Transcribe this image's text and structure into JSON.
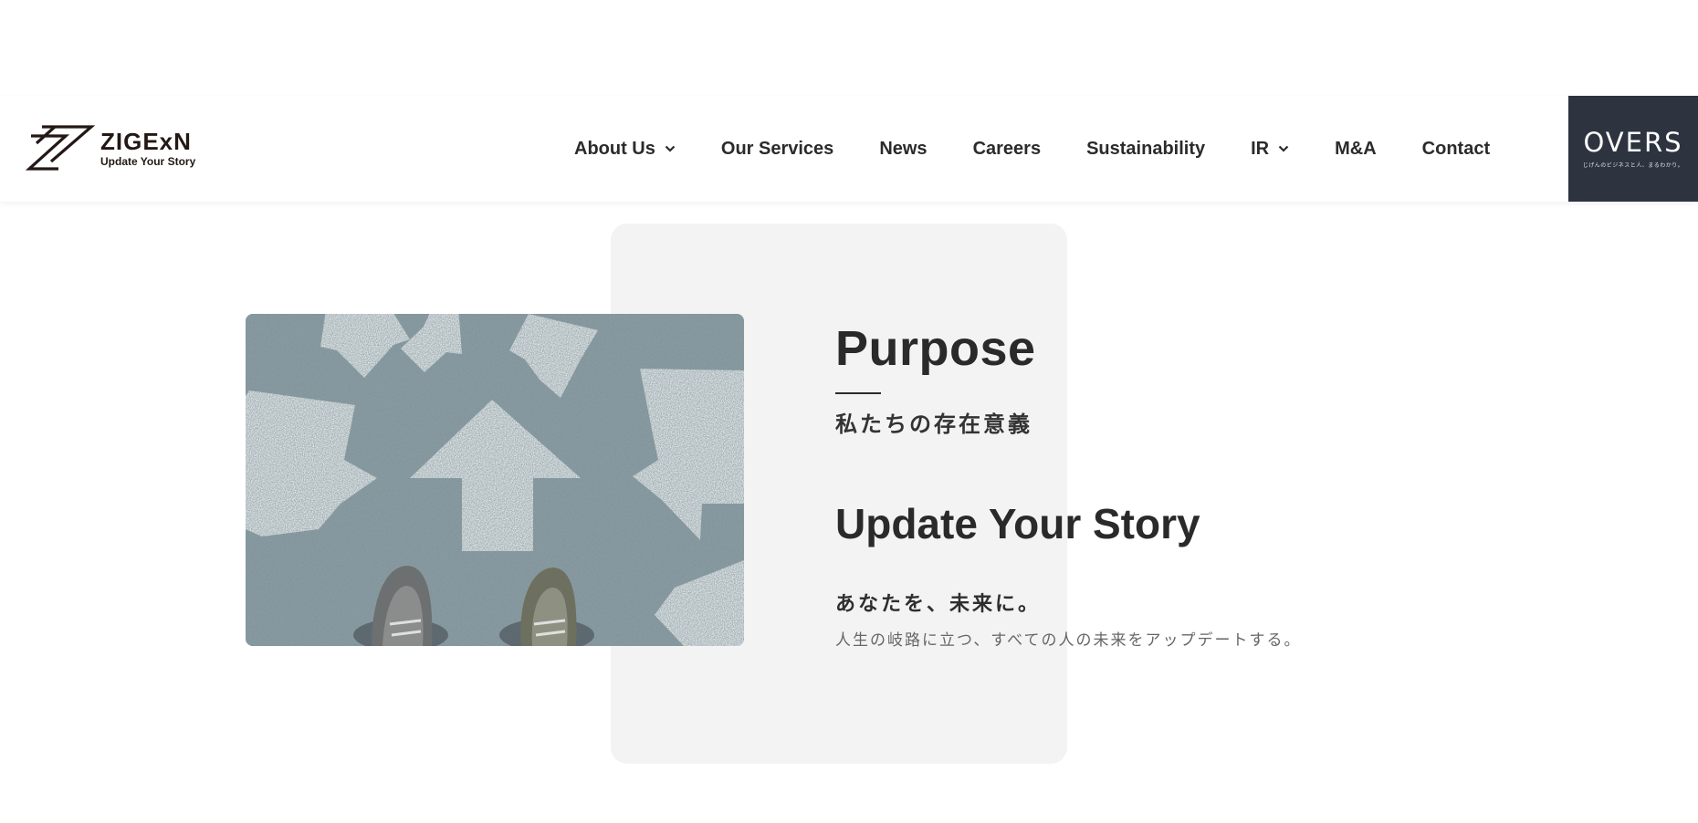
{
  "header": {
    "logo": {
      "name": "ZIGExN",
      "tagline": "Update Your Story"
    },
    "nav": [
      {
        "label": "About Us",
        "has_dropdown": true
      },
      {
        "label": "Our Services",
        "has_dropdown": false
      },
      {
        "label": "News",
        "has_dropdown": false
      },
      {
        "label": "Careers",
        "has_dropdown": false
      },
      {
        "label": "Sustainability",
        "has_dropdown": false
      },
      {
        "label": "IR",
        "has_dropdown": true
      },
      {
        "label": "M&A",
        "has_dropdown": false
      },
      {
        "label": "Contact",
        "has_dropdown": false
      }
    ],
    "overs": {
      "name": "OVERS",
      "subtitle": "じげんのビジネスと人、まるわかり。"
    }
  },
  "purpose": {
    "title": "Purpose",
    "subtitle": "私たちの存在意義",
    "story_title": "Update Your Story",
    "lead": "あなたを、未来に。",
    "body": "人生の岐路に立つ、すべての人の未来をアップデートする。"
  },
  "colors": {
    "text": "#222222",
    "overs_bg": "#2d333f",
    "panel_bg": "#f3f3f3",
    "photo_ground": "#7f9299"
  },
  "icons": {
    "dropdown": "chevron-down-icon",
    "logo": "zigexn-logo-mark"
  }
}
